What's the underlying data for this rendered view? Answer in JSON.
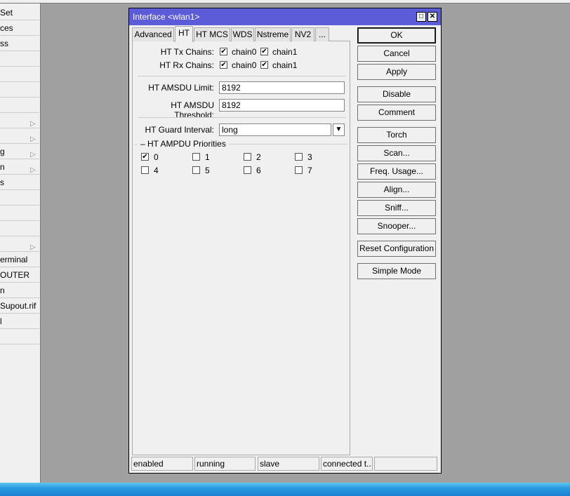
{
  "sidebar": {
    "items": [
      {
        "label": "Set",
        "arrow": false
      },
      {
        "label": "ces",
        "arrow": false
      },
      {
        "label": "ss",
        "arrow": false
      },
      {
        "label": "",
        "arrow": false
      },
      {
        "label": "",
        "arrow": false
      },
      {
        "label": "",
        "arrow": false
      },
      {
        "label": "",
        "arrow": false
      },
      {
        "label": "",
        "arrow": true
      },
      {
        "label": "",
        "arrow": true
      },
      {
        "label": "g",
        "arrow": true
      },
      {
        "label": "n",
        "arrow": true
      },
      {
        "label": "s",
        "arrow": false
      },
      {
        "label": "",
        "arrow": false
      },
      {
        "label": "",
        "arrow": false
      },
      {
        "label": "",
        "arrow": false
      },
      {
        "label": "",
        "arrow": true
      },
      {
        "label": "erminal",
        "arrow": false
      },
      {
        "label": "OUTER",
        "arrow": false
      },
      {
        "label": "n",
        "arrow": false
      },
      {
        "label": "Supout.rif",
        "arrow": false
      },
      {
        "label": "l",
        "arrow": false
      },
      {
        "label": "",
        "arrow": false
      }
    ]
  },
  "window": {
    "title": "Interface <wlan1>",
    "tabs": [
      "Advanced",
      "HT",
      "HT MCS",
      "WDS",
      "Nstreme",
      "NV2",
      "..."
    ],
    "active_tab": "HT",
    "ht": {
      "tx_label": "HT Tx Chains:",
      "rx_label": "HT Rx Chains:",
      "chain0": "chain0",
      "chain1": "chain1",
      "tx": {
        "chain0": true,
        "chain1": true
      },
      "rx": {
        "chain0": true,
        "chain1": true
      },
      "amsdu_limit_label": "HT AMSDU Limit:",
      "amsdu_limit": "8192",
      "amsdu_threshold_label": "HT AMSDU Threshold:",
      "amsdu_threshold": "8192",
      "guard_label": "HT Guard Interval:",
      "guard": "long",
      "ampdu_label": "HT AMPDU Priorities",
      "priorities": [
        {
          "label": "0",
          "checked": true
        },
        {
          "label": "1",
          "checked": false
        },
        {
          "label": "2",
          "checked": false
        },
        {
          "label": "3",
          "checked": false
        },
        {
          "label": "4",
          "checked": false
        },
        {
          "label": "5",
          "checked": false
        },
        {
          "label": "6",
          "checked": false
        },
        {
          "label": "7",
          "checked": false
        }
      ]
    },
    "buttons": [
      "OK",
      "Cancel",
      "Apply",
      "Disable",
      "Comment",
      "Torch",
      "Scan...",
      "Freq. Usage...",
      "Align...",
      "Sniff...",
      "Snooper...",
      "Reset Configuration",
      "Simple Mode"
    ],
    "status": [
      "enabled",
      "running",
      "slave",
      "connected t...",
      ""
    ]
  }
}
